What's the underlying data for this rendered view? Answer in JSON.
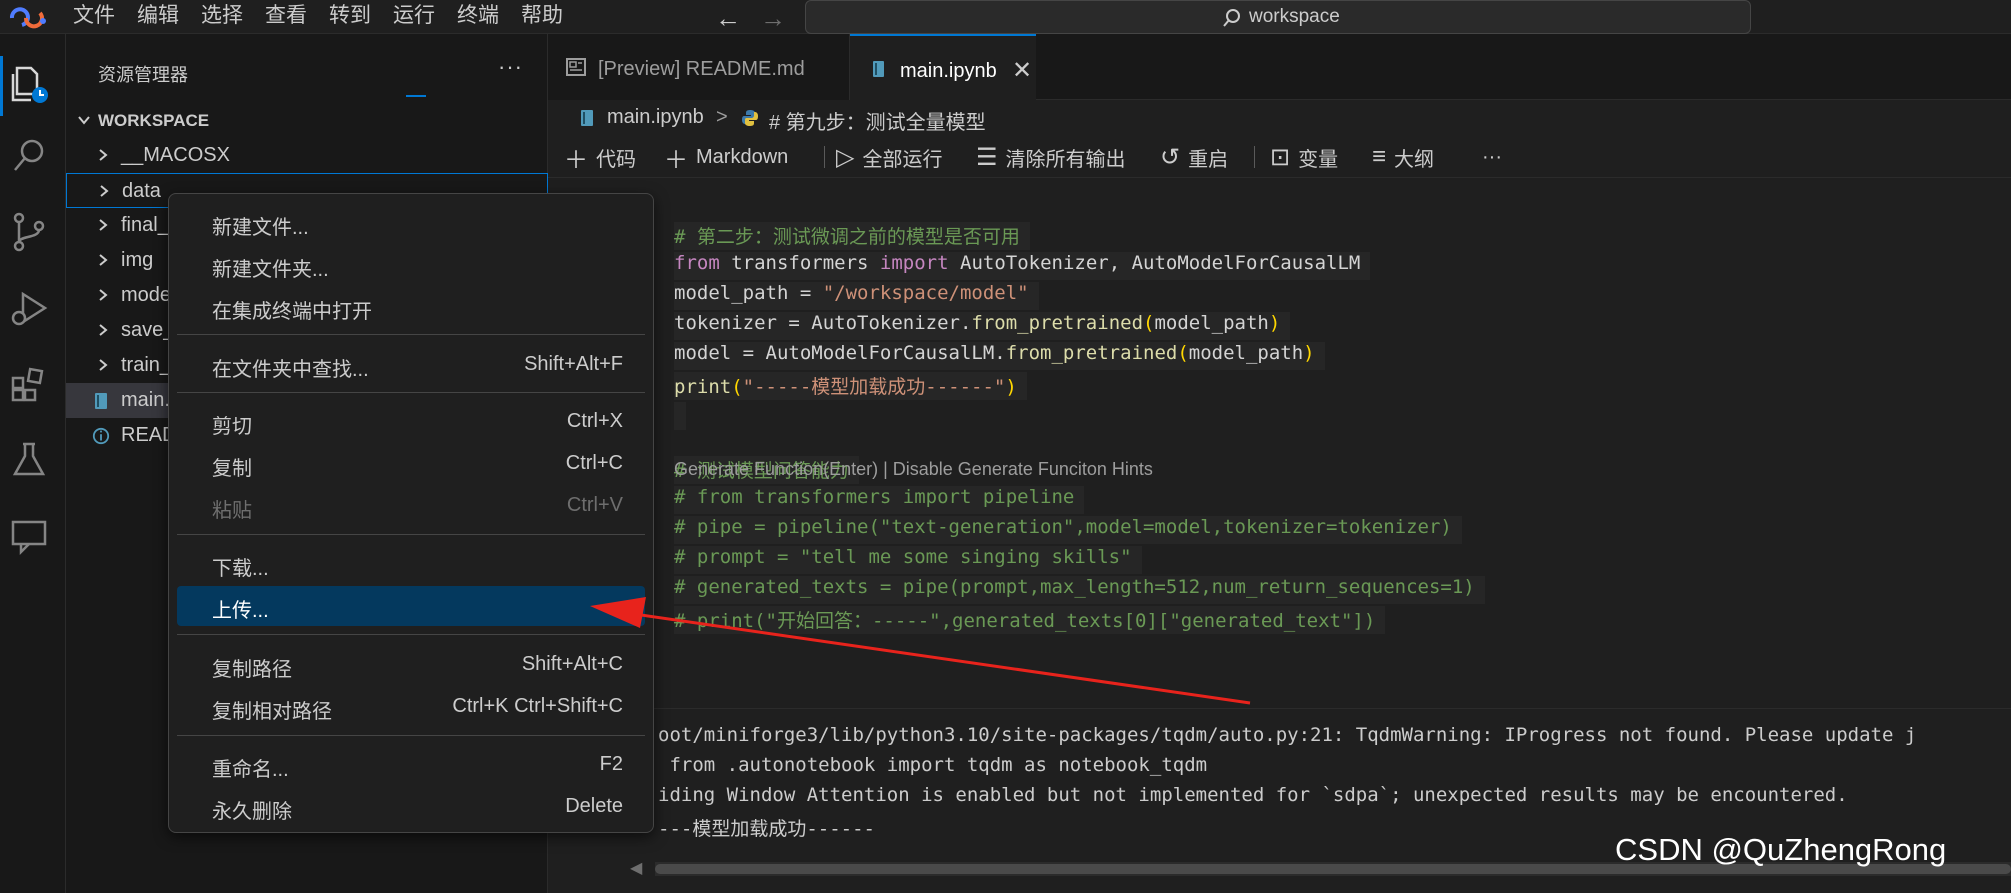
{
  "titlebar": {
    "menus": [
      "文件",
      "编辑",
      "选择",
      "查看",
      "转到",
      "运行",
      "终端",
      "帮助"
    ],
    "search_text": "workspace"
  },
  "sidebar": {
    "title": "资源管理器",
    "more": "···",
    "workspace_label": "WORKSPACE",
    "items": [
      {
        "label": "__MACOSX"
      },
      {
        "label": "data"
      },
      {
        "label": "final_"
      },
      {
        "label": "img"
      },
      {
        "label": "mode"
      },
      {
        "label": "save_"
      },
      {
        "label": "train_"
      },
      {
        "label": "main."
      },
      {
        "label": "READ"
      }
    ]
  },
  "tabs": [
    {
      "label": "[Preview] README.md"
    },
    {
      "label": "main.ipynb"
    }
  ],
  "breadcrumb": {
    "file": "main.ipynb",
    "separator": ">",
    "cell": "# 第九步：测试全量模型"
  },
  "notebook_toolbar": {
    "code": "代码",
    "markdown": "Markdown",
    "run_all": "全部运行",
    "clear_outputs": "清除所有输出",
    "restart": "重启",
    "variables": "变量",
    "outline": "大纲",
    "more": "···"
  },
  "cell": {
    "inline_hint": "Generate Function(Enter) | Disable Generate Funciton Hints"
  },
  "output": {
    "lines": [
      "oot/miniforge3/lib/python3.10/site-packages/tqdm/auto.py:21: TqdmWarning: IProgress not found. Please update j",
      " from .autonotebook import tqdm as notebook_tqdm",
      "iding Window Attention is enabled but not implemented for `sdpa`; unexpected results may be encountered.",
      "---模型加载成功------"
    ]
  },
  "watermark": "CSDN @QuZhengRong",
  "context_menu": {
    "items": [
      {
        "label": "新建文件...",
        "shortcut": ""
      },
      {
        "label": "新建文件夹...",
        "shortcut": ""
      },
      {
        "label": "在集成终端中打开",
        "shortcut": ""
      },
      {
        "label": "在文件夹中查找...",
        "shortcut": "Shift+Alt+F"
      },
      {
        "label": "剪切",
        "shortcut": "Ctrl+X"
      },
      {
        "label": "复制",
        "shortcut": "Ctrl+C"
      },
      {
        "label": "粘贴",
        "shortcut": "Ctrl+V"
      },
      {
        "label": "下载...",
        "shortcut": ""
      },
      {
        "label": "上传...",
        "shortcut": ""
      },
      {
        "label": "复制路径",
        "shortcut": "Shift+Alt+C"
      },
      {
        "label": "复制相对路径",
        "shortcut": "Ctrl+K Ctrl+Shift+C"
      },
      {
        "label": "重命名...",
        "shortcut": "F2"
      },
      {
        "label": "永久删除",
        "shortcut": "Delete"
      }
    ]
  },
  "colors": {
    "accent": "#0078d4",
    "menu_highlight": "#04395e",
    "annotation_arrow": "#e8231c",
    "comment": "#6a9955",
    "keyword": "#c586c0",
    "string": "#ce9178",
    "function": "#dcdcaa"
  }
}
